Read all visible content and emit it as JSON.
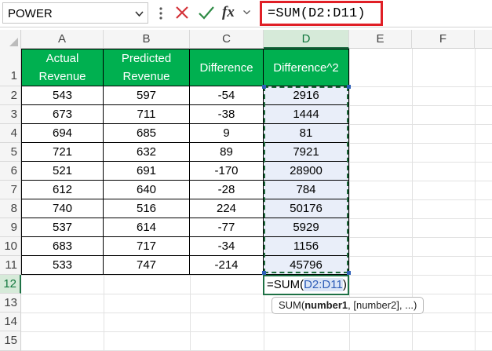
{
  "formula_bar": {
    "name_box": "POWER",
    "formula": "=SUM(D2:D11)",
    "fx_label": "fx"
  },
  "columns": [
    "A",
    "B",
    "C",
    "D",
    "E",
    "F"
  ],
  "rows": [
    "1",
    "2",
    "3",
    "4",
    "5",
    "6",
    "7",
    "8",
    "9",
    "10",
    "11",
    "12",
    "13",
    "14",
    "15"
  ],
  "table": {
    "headers": {
      "a_line1": "Actual",
      "a_line2": "Revenue",
      "b_line1": "Predicted",
      "b_line2": "Revenue",
      "c": "Difference",
      "d": "Difference^2"
    },
    "data": [
      [
        "543",
        "597",
        "-54",
        "2916"
      ],
      [
        "673",
        "711",
        "-38",
        "1444"
      ],
      [
        "694",
        "685",
        "9",
        "81"
      ],
      [
        "721",
        "632",
        "89",
        "7921"
      ],
      [
        "521",
        "691",
        "-170",
        "28900"
      ],
      [
        "612",
        "640",
        "-28",
        "784"
      ],
      [
        "740",
        "516",
        "224",
        "50176"
      ],
      [
        "537",
        "614",
        "-77",
        "5929"
      ],
      [
        "683",
        "717",
        "-34",
        "1156"
      ],
      [
        "533",
        "747",
        "-214",
        "45796"
      ]
    ]
  },
  "active_cell": {
    "prefix": "=SUM(",
    "range": "D2:D11",
    "suffix": ")"
  },
  "tooltip": {
    "fn": "SUM(",
    "arg1": "number1",
    "rest": ", [number2], ...)"
  },
  "colors": {
    "header_fill": "#00b050",
    "selection_green": "#1e7145",
    "formula_border": "#e01f26",
    "range_highlight": "#e9eef9"
  }
}
